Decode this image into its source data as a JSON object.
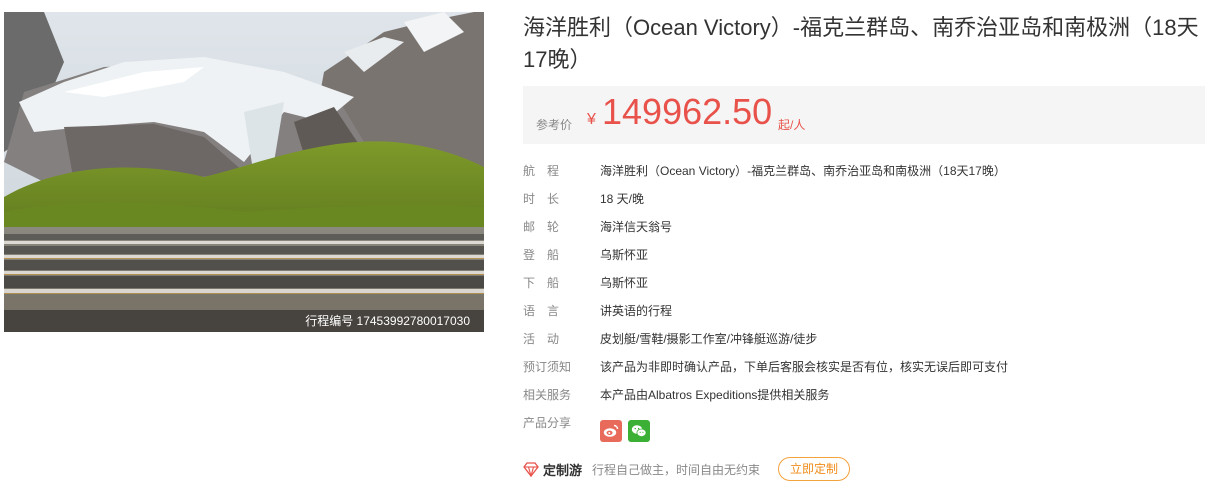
{
  "photo": {
    "alt_subject": "glacier-penguin-colony-photo",
    "caption": "行程编号 17453992780017030"
  },
  "product": {
    "title": "海洋胜利（Ocean Victory）-福克兰群岛、南乔治亚岛和南极洲（18天17晚）"
  },
  "price": {
    "label": "参考价",
    "currency": "¥",
    "value": "149962.50",
    "unit": "起/人",
    "color": "#e8524a"
  },
  "details": [
    {
      "key": "route",
      "label": "航　程",
      "value": "海洋胜利（Ocean Victory）-福克兰群岛、南乔治亚岛和南极洲（18天17晚）"
    },
    {
      "key": "duration",
      "label": "时　长",
      "value": "18 天/晚"
    },
    {
      "key": "ship",
      "label": "邮　轮",
      "value": "海洋信天翁号"
    },
    {
      "key": "embark",
      "label": "登　船",
      "value": "乌斯怀亚"
    },
    {
      "key": "disembark",
      "label": "下　船",
      "value": "乌斯怀亚"
    },
    {
      "key": "language",
      "label": "语　言",
      "value": "讲英语的行程"
    },
    {
      "key": "activities",
      "label": "活　动",
      "value": "皮划艇/雪鞋/摄影工作室/冲锋艇巡游/徒步"
    },
    {
      "key": "booking_notes",
      "label": "预订须知",
      "value": "该产品为非即时确认产品，下单后客服会核实是否有位，核实无误后即可支付"
    },
    {
      "key": "services",
      "label": "相关服务",
      "value": "本产品由Albatros Expeditions提供相关服务"
    }
  ],
  "share": {
    "label": "产品分享",
    "icons": [
      "weibo-icon",
      "wechat-icon"
    ]
  },
  "custom_tour": {
    "icon": "diamond-icon",
    "title": "定制游",
    "description": "行程自己做主，时间自由无约束",
    "button_label": "立即定制",
    "accent_color": "#f08c1a"
  }
}
